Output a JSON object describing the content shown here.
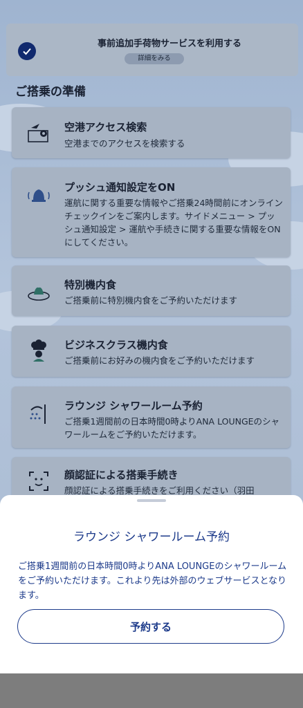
{
  "baggage": {
    "title": "事前追加手荷物サービスを利用する",
    "details": "詳細をみる"
  },
  "section_title": "ご搭乗の準備",
  "cards": [
    {
      "title": "空港アクセス検索",
      "desc": "空港までのアクセスを検索する",
      "icon": "airport-map-icon"
    },
    {
      "title": "プッシュ通知設定をON",
      "desc": "運航に関する重要な情報やご搭乗24時間前にオンラインチェックインをご案内します。サイドメニュー > プッシュ通知設定 > 運航や手続きに関する重要な情報をONにしてください。",
      "icon": "bell-icon"
    },
    {
      "title": "特別機内食",
      "desc": "ご搭乗前に特別機内食をご予約いただけます",
      "icon": "meal-plate-icon"
    },
    {
      "title": "ビジネスクラス機内食",
      "desc": "ご搭乗前にお好みの機内食をご予約いただけます",
      "icon": "chef-icon"
    },
    {
      "title": "ラウンジ シャワールーム予約",
      "desc": "ご搭乗1週間前の日本時間0時よりANA LOUNGEのシャワールームをご予約いただけます。",
      "icon": "shower-icon"
    },
    {
      "title": "顔認証による搭乗手続き",
      "desc": "顔認証による搭乗手続きをご利用ください（羽田",
      "icon": "face-recognition-icon"
    }
  ],
  "sheet": {
    "title": "ラウンジ シャワールーム予約",
    "desc": "ご搭乗1週間前の日本時間0時よりANA LOUNGEのシャワールームをご予約いただけます。これより先は外部のウェブサービスとなります。",
    "button": "予約する"
  },
  "colors": {
    "brand": "#1c3a8a",
    "check": "#112a6e"
  }
}
